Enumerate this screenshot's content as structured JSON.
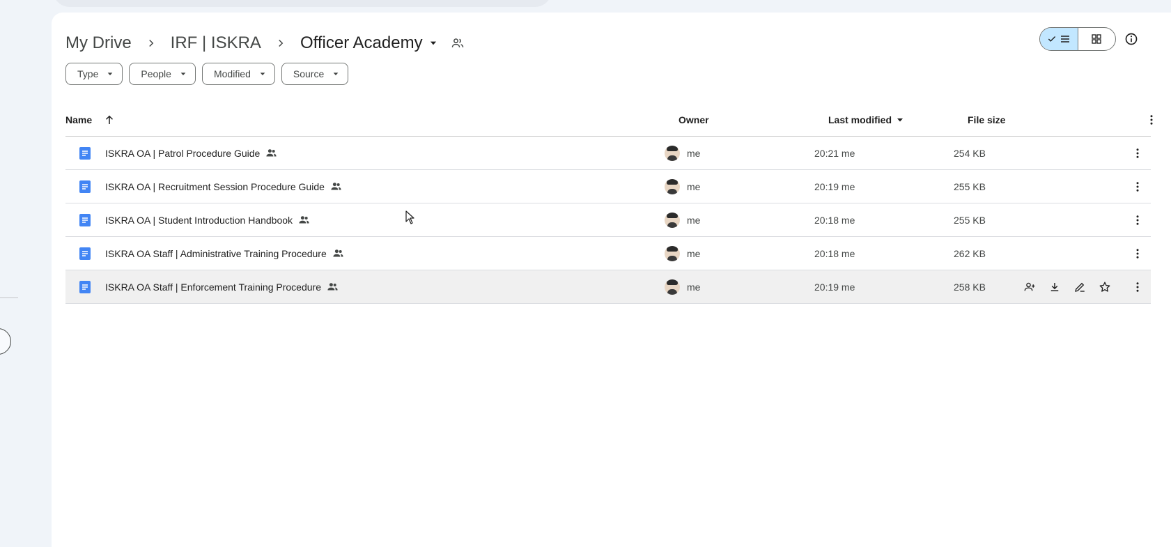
{
  "breadcrumb": {
    "items": [
      "My Drive",
      "IRF | ISKRA"
    ],
    "current": "Officer Academy"
  },
  "filters": [
    "Type",
    "People",
    "Modified",
    "Source"
  ],
  "columns": {
    "name": "Name",
    "owner": "Owner",
    "last_modified": "Last modified",
    "file_size": "File size"
  },
  "files": [
    {
      "name": "ISKRA OA | Patrol Procedure Guide",
      "owner": "me",
      "modified": "20:21 me",
      "size": "254 KB"
    },
    {
      "name": "ISKRA OA | Recruitment Session Procedure Guide",
      "owner": "me",
      "modified": "20:19 me",
      "size": "255 KB"
    },
    {
      "name": "ISKRA OA | Student Introduction Handbook",
      "owner": "me",
      "modified": "20:18 me",
      "size": "255 KB"
    },
    {
      "name": "ISKRA OA Staff | Administrative Training Procedure",
      "owner": "me",
      "modified": "20:18 me",
      "size": "262 KB"
    },
    {
      "name": "ISKRA OA Staff | Enforcement Training Procedure",
      "owner": "me",
      "modified": "20:19 me",
      "size": "258 KB"
    }
  ],
  "colors": {
    "doc_blue": "#4285f4",
    "toggle_active": "#c2e7ff",
    "hover_row": "#f0f0f0"
  }
}
